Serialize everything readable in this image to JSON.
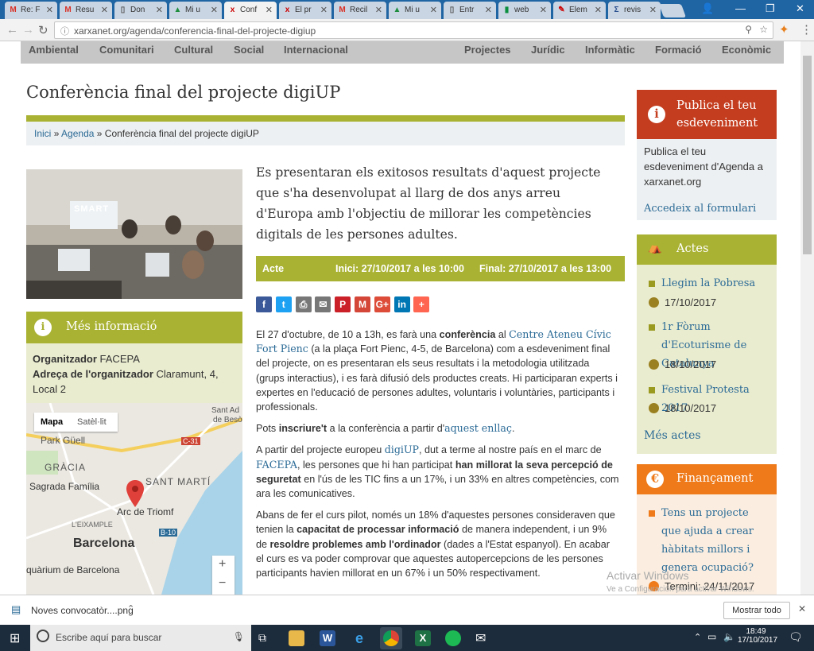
{
  "browser": {
    "tabs": [
      {
        "icon": "M",
        "color": "#d93025",
        "label": "Re: F"
      },
      {
        "icon": "M",
        "color": "#d93025",
        "label": "Resu"
      },
      {
        "icon": "▯",
        "color": "#555",
        "label": "Don"
      },
      {
        "icon": "▲",
        "color": "#1e8e3e",
        "label": "Mi u"
      },
      {
        "icon": "x",
        "color": "#c00",
        "label": "Conf"
      },
      {
        "icon": "x",
        "color": "#c00",
        "label": "El pr"
      },
      {
        "icon": "M",
        "color": "#d93025",
        "label": "Recil"
      },
      {
        "icon": "▲",
        "color": "#1e8e3e",
        "label": "Mi u"
      },
      {
        "icon": "▯",
        "color": "#555",
        "label": "Entr"
      },
      {
        "icon": "▮",
        "color": "#0a8f3f",
        "label": "web"
      },
      {
        "icon": "✎",
        "color": "#c00",
        "label": "Elem"
      },
      {
        "icon": "Σ",
        "color": "#2a4f8f",
        "label": "revis"
      }
    ],
    "url": "xarxanet.org/agenda/conferencia-final-del-projecte-digiup"
  },
  "nav": {
    "left": [
      "Ambiental",
      "Comunitari",
      "Cultural",
      "Social",
      "Internacional"
    ],
    "right": [
      "Projectes",
      "Jurídic",
      "Informàtic",
      "Formació",
      "Econòmic"
    ]
  },
  "page": {
    "title": "Conferència final del projecte digiUP",
    "breadcrumb": {
      "home": "Inici",
      "sep": "»",
      "agenda": "Agenda",
      "current": "Conferència final del projecte digiUP"
    },
    "photo_text": "SMART",
    "intro": "Es presentaran els exitosos resultats d'aquest projecte que s'ha desenvolupat al llarg de dos anys arreu d'Europa amb l'objectiu de millorar les competències digitals de les persones adultes.",
    "event": {
      "type": "Acte",
      "start": "Inici: 27/10/2017 a les 10:00",
      "end": "Final: 27/10/2017 a les 13:00"
    },
    "share_icons": [
      {
        "name": "facebook-icon",
        "glyph": "f",
        "color": "#3b5998"
      },
      {
        "name": "twitter-icon",
        "glyph": "t",
        "color": "#1da1f2"
      },
      {
        "name": "print-icon",
        "glyph": "⎙",
        "color": "#777"
      },
      {
        "name": "email-icon",
        "glyph": "✉",
        "color": "#777"
      },
      {
        "name": "pinterest-icon",
        "glyph": "P",
        "color": "#cb2027"
      },
      {
        "name": "gmail-icon",
        "glyph": "M",
        "color": "#d44638"
      },
      {
        "name": "google-plus-icon",
        "glyph": "G+",
        "color": "#dd4b39"
      },
      {
        "name": "linkedin-icon",
        "glyph": "in",
        "color": "#0077b5"
      },
      {
        "name": "more-share-icon",
        "glyph": "+",
        "color": "#ff6550"
      }
    ],
    "body": {
      "p1a": "El 27 d'octubre, de 10 a 13h, es farà una ",
      "p1b": "conferència",
      "p1c": " al ",
      "p1link": "Centre Ateneu Cívic Fort Pienc",
      "p1d": " (a la plaça Fort Pienc, 4-5, de Barcelona) com a esdeveniment final del projecte, on es presentaran els seus resultats i la metodologia utilitzada (grups interactius), i es farà difusió dels productes creats. Hi participaran experts i expertes en l'educació de persones adultes, voluntaris i voluntàries, participants i professionals.",
      "p2a": "Pots ",
      "p2b": "inscriure't",
      "p2c": " a la conferència a partir d'",
      "p2link": "aquest enllaç",
      "p2d": ".",
      "p3a": "A partir del projecte europeu ",
      "p3link1": "digiUP",
      "p3b": ", dut a terme al nostre país en el marc de ",
      "p3link2": "FACEPA",
      "p3c": ", les persones que hi han participat ",
      "p3d": "han millorat la seva percepció de seguretat",
      "p3e": " en l'ús de les TIC fins a un 17%, i un 33% en altres competències, com ara les comunicatives.",
      "p4a": "Abans de fer el curs pilot, només un 18% d'aquestes persones consideraven que tenien la ",
      "p4b": "capacitat de processar informació",
      "p4c": " de manera independent, i un 9% de ",
      "p4d": "resoldre problemes amb l'ordinador",
      "p4e": " (dades a l'Estat espanyol). En acabar el curs es va poder comprovar que aquestes autopercepcions de les persones participants havien millorat en un 67% i un 50% respectivament."
    },
    "more_info": {
      "title": "Més informació",
      "org_label": "Organitzador",
      "org_value": "FACEPA",
      "addr_label": "Adreça de l'organitzador",
      "addr_value": "Claramunt, 4, Local 2"
    },
    "map": {
      "tab_map": "Mapa",
      "tab_sat": "Satèl·lit",
      "labels": [
        "Park Güell",
        "GRÀCIA",
        "Sagrada Família",
        "SANT MARTÍ",
        "Arc de Triomf",
        "L'EIXAMPLE",
        "Barcelona",
        "quàrium de Barcelona",
        "Sant Ad",
        "de Besò",
        "C-31",
        "B-10"
      ],
      "zoom_in": "+",
      "zoom_out": "−"
    }
  },
  "sidebar": {
    "publish": {
      "title": "Publica el teu esdeveniment",
      "text": "Publica el teu esdeveniment d'Agenda a xarxanet.org",
      "link": "Accedeix al formulari"
    },
    "actes": {
      "title": "Actes",
      "items": [
        {
          "title": "Llegim la Pobresa",
          "date": "17/10/2017"
        },
        {
          "title": "1r Fòrum d'Ecoturisme de Catalunya",
          "date": "18/10/2017"
        },
        {
          "title": "Festival Protesta 2017",
          "date": "18/10/2017"
        }
      ],
      "more": "Més actes"
    },
    "financament": {
      "title": "Finançament",
      "item": "Tens un projecte que ajuda a crear hàbitats millors i genera ocupació?",
      "deadline": "Termini: 24/11/2017"
    }
  },
  "watermark": {
    "line1": "Activar Windows",
    "line2": "Ve a Configuración para activar Windows."
  },
  "download": {
    "file": "Noves convocatòr....png",
    "show_all": "Mostrar todo"
  },
  "taskbar": {
    "search": "Escribe aquí para buscar",
    "time": "18:49",
    "date": "17/10/2017"
  }
}
